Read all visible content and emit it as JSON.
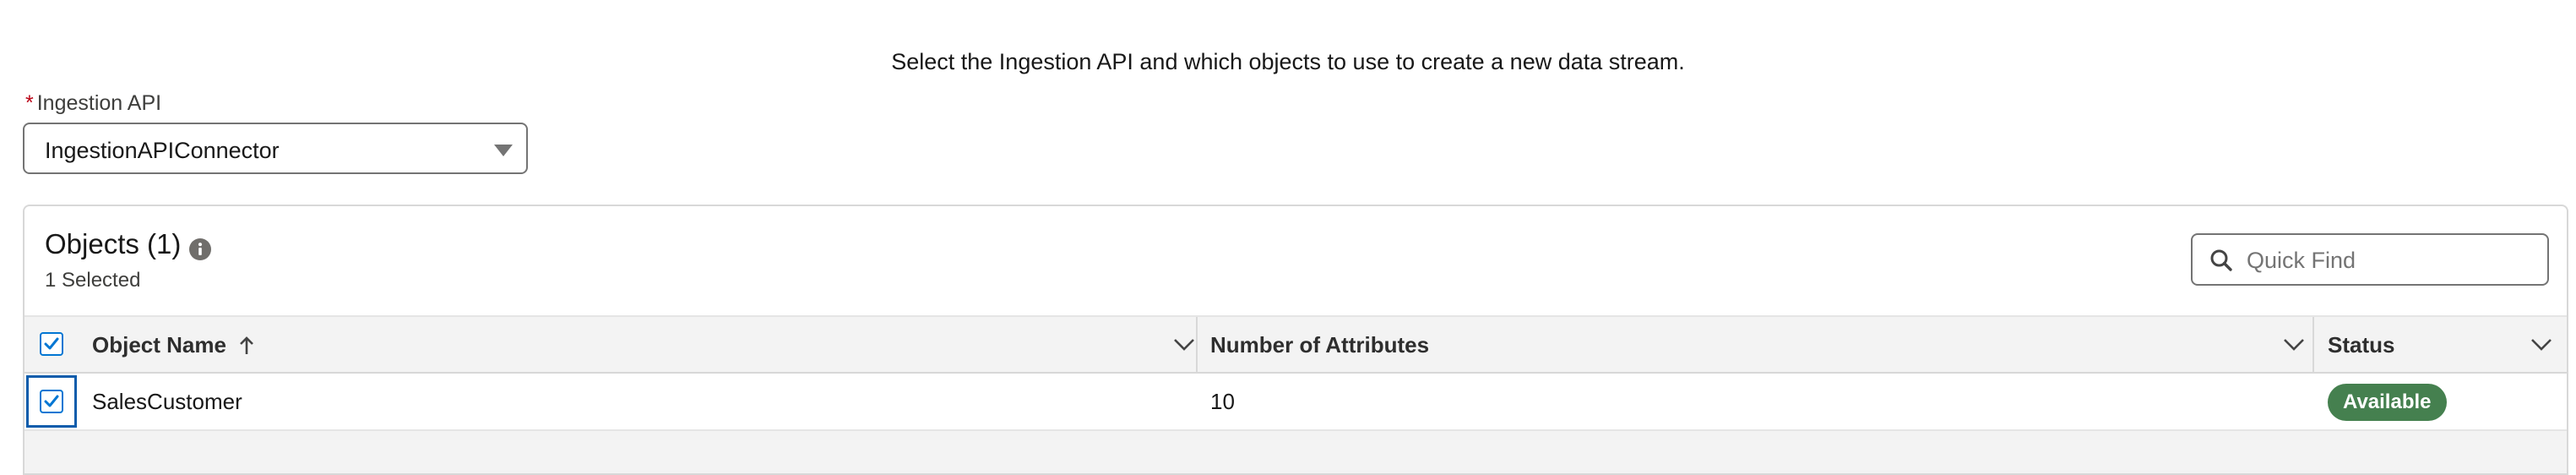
{
  "intro_text": "Select the Ingestion API and which objects to use to create a new data stream.",
  "ingestion_api": {
    "required_marker": "*",
    "label": "Ingestion API",
    "selected_value": "IngestionAPIConnector"
  },
  "objects_card": {
    "title": "Objects (1)",
    "selected_text": "1 Selected",
    "quick_find_placeholder": "Quick Find",
    "columns": [
      {
        "label": "Object Name",
        "sort": "ascending"
      },
      {
        "label": "Number of Attributes"
      },
      {
        "label": "Status"
      }
    ],
    "rows": [
      {
        "checked": true,
        "object_name": "SalesCustomer",
        "attributes": "10",
        "status": "Available"
      }
    ]
  },
  "colors": {
    "accent": "#0176d3",
    "status_available": "#45804f",
    "required": "#ba0517"
  },
  "icons": [
    "info-icon",
    "search-icon",
    "sort-arrow-up-icon",
    "chevron-down-icon",
    "check-icon",
    "dropdown-caret-icon"
  ]
}
